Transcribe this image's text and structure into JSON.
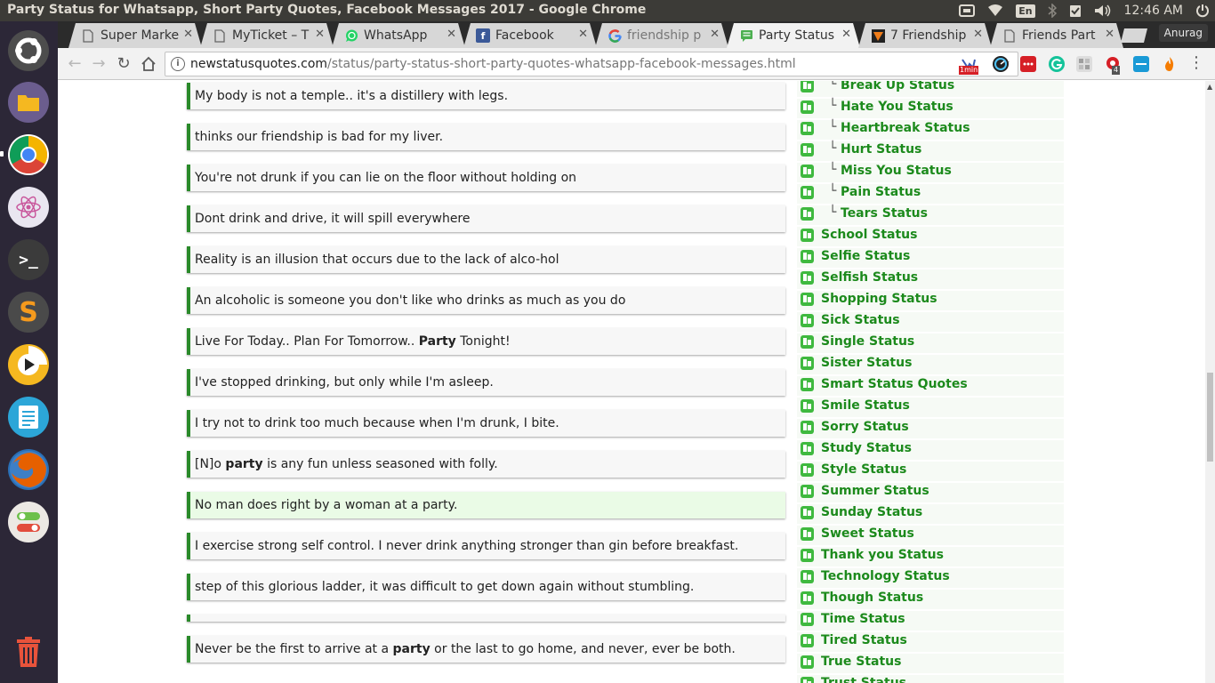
{
  "top_panel": {
    "window_title": "Party Status for Whatsapp, Short Party Quotes, Facebook Messages 2017 - Google Chrome",
    "keyboard_layout": "En",
    "clock": "12:46 AM",
    "icons": [
      "screen-icon",
      "wifi-icon",
      "keyboard-icon",
      "bluetooth-icon",
      "checkbox-icon",
      "volume-icon",
      "power-icon"
    ]
  },
  "launcher": {
    "apps": [
      {
        "name": "ubuntu-dash",
        "glyph": "◉",
        "color": "#4d4d4d"
      },
      {
        "name": "files",
        "glyph": "▬",
        "color": "#6b5d8e"
      },
      {
        "name": "chrome",
        "glyph": "●",
        "color": "#e04a3a"
      },
      {
        "name": "atom",
        "glyph": "⚛",
        "color": "#e9e6f0"
      },
      {
        "name": "terminal",
        "glyph": ">_",
        "color": "#3b3b3b"
      },
      {
        "name": "sublime-text",
        "glyph": "S",
        "color": "#4a4a4a"
      },
      {
        "name": "media-player",
        "glyph": "▶",
        "color": "#f5b820"
      },
      {
        "name": "text-editor",
        "glyph": "≡",
        "color": "#2ca6d8"
      },
      {
        "name": "firefox",
        "glyph": "◐",
        "color": "#e66000"
      },
      {
        "name": "toggle-app",
        "glyph": "◧",
        "color": "#ece9e4"
      },
      {
        "name": "trash",
        "glyph": "🗑",
        "color": "#2c2737"
      }
    ]
  },
  "tabs": [
    {
      "label": "Super Marke",
      "favicon": "doc",
      "active": false
    },
    {
      "label": "MyTicket – T",
      "favicon": "doc",
      "active": false
    },
    {
      "label": "WhatsApp",
      "favicon": "whatsapp",
      "active": false
    },
    {
      "label": "Facebook",
      "favicon": "facebook",
      "active": false
    },
    {
      "label": "friendship p",
      "favicon": "google",
      "active": false
    },
    {
      "label": "Party Status",
      "favicon": "chat",
      "active": true
    },
    {
      "label": "7 Friendship",
      "favicon": "brand",
      "active": false
    },
    {
      "label": "Friends Part",
      "favicon": "doc",
      "active": false
    }
  ],
  "profile_name": "Anurag",
  "address_bar": {
    "host": "newstatusquotes.com",
    "path": "/status/party-status-short-party-quotes-whatsapp-facebook-messages.html"
  },
  "extension_badges": {
    "reading_time": "1min",
    "notification_count": "4"
  },
  "quotes": [
    {
      "pre": "My body is not a temple.. it's a distillery with legs.",
      "bold": "",
      "post": ""
    },
    {
      "pre": "thinks our friendship is bad for my liver.",
      "bold": "",
      "post": ""
    },
    {
      "pre": "You're not drunk if you can lie on the floor without holding on",
      "bold": "",
      "post": ""
    },
    {
      "pre": "Dont drink and drive, it will spill everywhere",
      "bold": "",
      "post": ""
    },
    {
      "pre": "Reality is an illusion that occurs due to the lack of alco-hol",
      "bold": "",
      "post": ""
    },
    {
      "pre": "An alcoholic is someone you don't like who drinks as much as you do",
      "bold": "",
      "post": ""
    },
    {
      "pre": "Live For Today.. Plan For Tomorrow.. ",
      "bold": "Party",
      "post": " Tonight!"
    },
    {
      "pre": "I've stopped drinking, but only while I'm asleep.",
      "bold": "",
      "post": ""
    },
    {
      "pre": "I try not to drink too much because when I'm drunk, I bite.",
      "bold": "",
      "post": ""
    },
    {
      "pre": "[N]o ",
      "bold": "party",
      "post": " is any fun unless seasoned with folly."
    },
    {
      "pre": "No man does right by a woman at a party.",
      "bold": "",
      "post": ""
    },
    {
      "pre": "I exercise strong self control. I never drink anything stronger than gin before breakfast.",
      "bold": "",
      "post": ""
    },
    {
      "pre": "step of this glorious ladder, it was difficult to get down again without stumbling.",
      "bold": "",
      "post": ""
    },
    {
      "pre": "",
      "bold": "",
      "post": ""
    },
    {
      "pre": "Never be the first to arrive at a ",
      "bold": "party",
      "post": " or the last to go home, and never, ever be both."
    }
  ],
  "sidebar": {
    "sub_items": [
      "Break Up Status",
      "Hate You Status",
      "Heartbreak Status",
      "Hurt Status",
      "Miss You Status",
      "Pain Status",
      "Tears Status"
    ],
    "sub_prefix": "└",
    "items": [
      "School Status",
      "Selfie Status",
      "Selfish Status",
      "Shopping Status",
      "Sick Status",
      "Single Status",
      "Sister Status",
      "Smart Status Quotes",
      "Smile Status",
      "Sorry Status",
      "Study Status",
      "Style Status",
      "Summer Status",
      "Sunday Status",
      "Sweet Status",
      "Thank you Status",
      "Technology Status",
      "Though Status",
      "Time Status",
      "Tired Status",
      "True Status",
      "Trust Status"
    ]
  }
}
